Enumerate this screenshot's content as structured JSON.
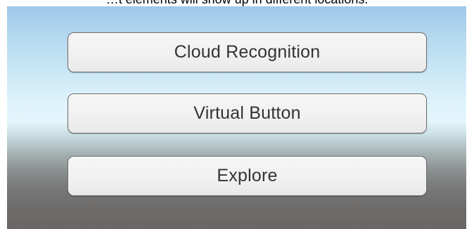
{
  "caption": {
    "text": "…t elements will show up in different locations."
  },
  "menu": {
    "buttons": [
      {
        "label": "Cloud Recognition"
      },
      {
        "label": "Virtual Button"
      },
      {
        "label": "Explore"
      }
    ]
  }
}
